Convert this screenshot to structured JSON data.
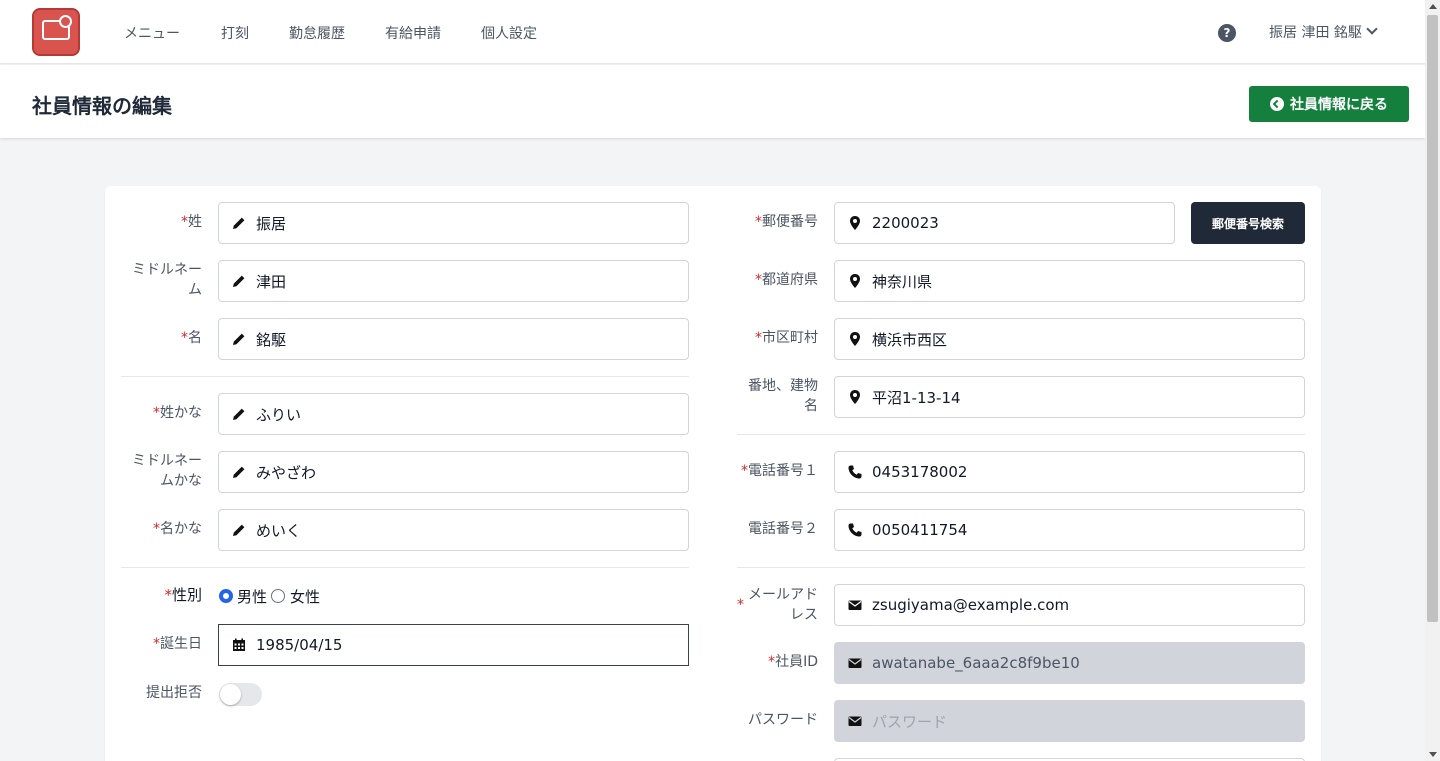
{
  "nav": {
    "items": [
      "メニュー",
      "打刻",
      "勤怠履歴",
      "有給申請",
      "個人設定"
    ],
    "help_symbol": "?",
    "user_name": "振居 津田 銘駆"
  },
  "header": {
    "title": "社員情報の編集",
    "back_label": "社員情報に戻る"
  },
  "required_mark": "*",
  "form": {
    "last_name": {
      "label": "姓",
      "value": "振居"
    },
    "middle_name": {
      "label": "ミドルネーム",
      "value": "津田"
    },
    "first_name": {
      "label": "名",
      "value": "銘駆"
    },
    "last_name_kana": {
      "label": "姓かな",
      "value": "ふりい"
    },
    "middle_name_kana": {
      "label": "ミドルネームかな",
      "value": "みやざわ"
    },
    "first_name_kana": {
      "label": "名かな",
      "value": "めいく"
    },
    "gender": {
      "label": "性別",
      "options": [
        "男性",
        "女性"
      ],
      "selected": "男性"
    },
    "birthday": {
      "label": "誕生日",
      "value": "1985/04/15"
    },
    "refusal": {
      "label": "提出拒否",
      "on": false
    },
    "postal_code": {
      "label": "郵便番号",
      "value": "2200023",
      "search_label": "郵便番号検索"
    },
    "prefecture": {
      "label": "都道府県",
      "value": "神奈川県"
    },
    "city": {
      "label": "市区町村",
      "value": "横浜市西区"
    },
    "address": {
      "label": "番地、建物名",
      "value": "平沼1-13-14"
    },
    "phone1": {
      "label": "電話番号１",
      "value": "0453178002"
    },
    "phone2": {
      "label": "電話番号２",
      "value": "0050411754"
    },
    "email": {
      "label": "メールアドレス",
      "value": "zsugiyama@example.com"
    },
    "employee_id": {
      "label": "社員ID",
      "value": "awatanabe_6aaa2c8f9be10"
    },
    "password": {
      "label": "パスワード",
      "placeholder": "パスワード"
    }
  },
  "colors": {
    "primary_green": "#15803d",
    "dark_button": "#1f2937",
    "required_red": "#dc2626",
    "radio_blue": "#2563eb",
    "logo_red": "#d9534f"
  },
  "icons": {
    "name_fields": "pencil-icon",
    "address_fields": "map-marker-icon",
    "phone_fields": "phone-icon",
    "email_fields": "envelope-icon",
    "birthday": "calendar-icon"
  }
}
